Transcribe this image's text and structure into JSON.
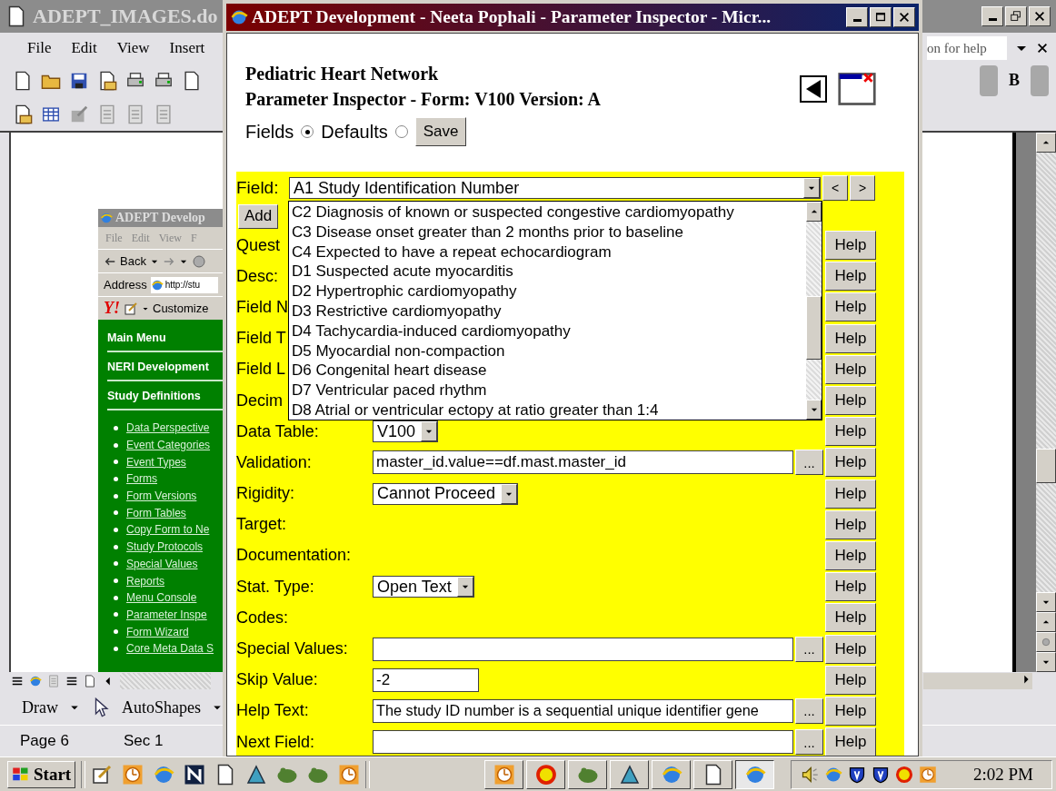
{
  "word_window": {
    "title": "ADEPT_IMAGES.do",
    "menu": [
      "File",
      "Edit",
      "View",
      "Insert"
    ],
    "help_box": "on for help",
    "bold_button": "B",
    "draw_toolbar": [
      "Draw",
      "AutoShapes"
    ],
    "status_bar": [
      "Page 6",
      "Sec 1"
    ]
  },
  "browser_window": {
    "title": "ADEPT Develop",
    "menu": [
      "File",
      "Edit",
      "View",
      "F"
    ],
    "back": "Back",
    "address_label": "Address",
    "address": "http://stu",
    "toolbar_logo": "Y!",
    "customize": "Customize",
    "nav": [
      {
        "kind": "heading",
        "label": "Main Menu"
      },
      {
        "kind": "heading",
        "label": "NERI Development"
      },
      {
        "kind": "heading",
        "label": "Study Definitions"
      },
      {
        "kind": "link",
        "label": "Data Perspective"
      },
      {
        "kind": "link",
        "label": "Event Categories"
      },
      {
        "kind": "link",
        "label": "Event Types"
      },
      {
        "kind": "link",
        "label": "Forms"
      },
      {
        "kind": "link",
        "label": "Form Versions"
      },
      {
        "kind": "link",
        "label": "Form Tables"
      },
      {
        "kind": "link",
        "label": "Copy Form to Ne"
      },
      {
        "kind": "link",
        "label": "Study Protocols"
      },
      {
        "kind": "link",
        "label": "Special Values"
      },
      {
        "kind": "link",
        "label": "Reports"
      },
      {
        "kind": "link",
        "label": "Menu Console"
      },
      {
        "kind": "link",
        "label": "Parameter Inspe"
      },
      {
        "kind": "link",
        "label": "Form Wizard"
      },
      {
        "kind": "link",
        "label": "Core Meta Data S"
      }
    ]
  },
  "popup": {
    "title": "ADEPT Development - Neeta Pophali - Parameter Inspector - Micr...",
    "heading": [
      "Pediatric Heart Network",
      "Parameter Inspector - Form: V100 Version: A"
    ],
    "modes": [
      {
        "label": "Fields",
        "selected": true
      },
      {
        "label": "Defaults",
        "selected": false
      }
    ],
    "save": "Save",
    "field_label": "Field:",
    "field_value": "A1 Study Identification Number",
    "nav_buttons": [
      "<",
      ">"
    ],
    "add": "Add",
    "dropdown": [
      "C2 Diagnosis of known or suspected congestive cardiomyopathy",
      "C3 Disease onset greater than 2 months prior to baseline",
      "C4 Expected to have a repeat echocardiogram",
      "D1 Suspected acute myocarditis",
      "D2 Hypertrophic cardiomyopathy",
      "D3 Restrictive cardiomyopathy",
      "D4 Tachycardia-induced cardiomyopathy",
      "D5 Myocardial non-compaction",
      "D6 Congenital heart disease",
      "D7 Ventricular paced rhythm",
      "D8 Atrial or ventricular ectopy at ratio greater than 1:4"
    ],
    "rows": [
      {
        "kind": "text",
        "label": "Quest",
        "help": "Help"
      },
      {
        "kind": "text",
        "label": "Desc:",
        "help": "Help"
      },
      {
        "kind": "text",
        "label": "Field N",
        "help": "Help"
      },
      {
        "kind": "text",
        "label": "Field T",
        "help": "Help"
      },
      {
        "kind": "text",
        "label": "Field L",
        "help": "Help"
      },
      {
        "kind": "text",
        "label": "Decim",
        "help": "Help"
      },
      {
        "kind": "select",
        "label": "Data Table:",
        "value": "V100",
        "help": "Help"
      },
      {
        "kind": "input_more",
        "label": "Validation:",
        "value": "master_id.value==df.mast.master_id",
        "more": "...",
        "help": "Help"
      },
      {
        "kind": "select",
        "label": "Rigidity:",
        "value": "Cannot Proceed",
        "help": "Help"
      },
      {
        "kind": "text",
        "label": "Target:",
        "help": "Help"
      },
      {
        "kind": "text",
        "label": "Documentation:",
        "help": "Help"
      },
      {
        "kind": "select",
        "label": "Stat. Type:",
        "value": "Open Text",
        "help": "Help"
      },
      {
        "kind": "text",
        "label": "Codes:",
        "help": "Help"
      },
      {
        "kind": "input_more",
        "label": "Special Values:",
        "more": "...",
        "help": "Help"
      },
      {
        "kind": "input",
        "label": "Skip Value:",
        "value": "-2",
        "help": "Help"
      },
      {
        "kind": "input_more",
        "label": "Help Text:",
        "value": "The study ID number is a sequential unique identifier gene",
        "more": "...",
        "help": "Help"
      },
      {
        "kind": "input_more",
        "label": "Next Field:",
        "more": "...",
        "help": "Help"
      }
    ]
  },
  "taskbar": {
    "start": "Start",
    "clock": "2:02 PM"
  }
}
